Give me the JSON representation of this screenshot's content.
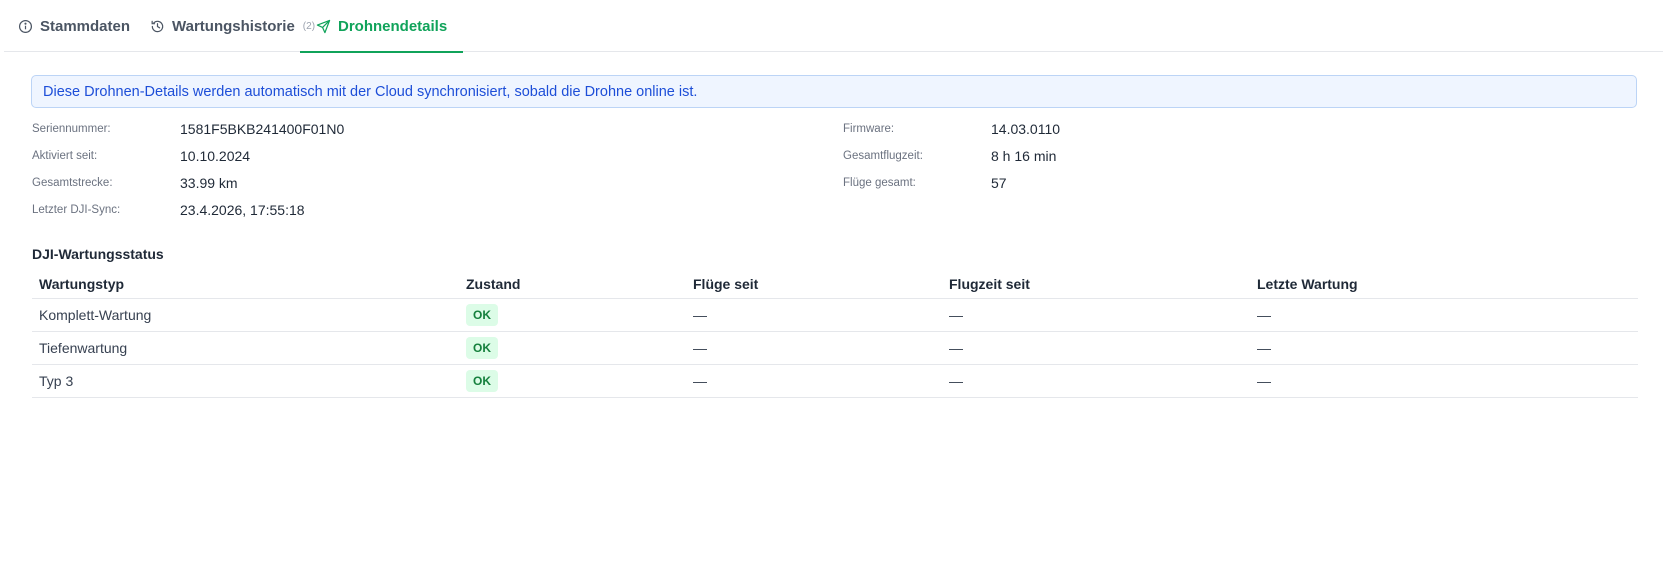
{
  "tabs": [
    {
      "label": "Stammdaten",
      "icon": "info-icon"
    },
    {
      "label": "Wartungshistorie",
      "count": "(2)",
      "icon": "history-icon"
    },
    {
      "label": "Drohnendetails",
      "icon": "send-icon",
      "active": true
    }
  ],
  "banner": "Diese Drohnen-Details werden automatisch mit der Cloud synchronisiert, sobald die Drohne online ist.",
  "details_left": [
    {
      "label": "Seriennummer:",
      "value": "1581F5BKB241400F01N0"
    },
    {
      "label": "Aktiviert seit:",
      "value": "10.10.2024"
    },
    {
      "label": "Gesamtstrecke:",
      "value": "33.99 km"
    },
    {
      "label": "Letzter DJI-Sync:",
      "value": "23.4.2026, 17:55:18"
    }
  ],
  "details_right": [
    {
      "label": "Firmware:",
      "value": "14.03.0110"
    },
    {
      "label": "Gesamtflugzeit:",
      "value": "8 h 16 min"
    },
    {
      "label": "Flüge gesamt:",
      "value": "57"
    }
  ],
  "maintenance": {
    "title": "DJI-Wartungsstatus",
    "headers": [
      "Wartungstyp",
      "Zustand",
      "Flüge seit",
      "Flugzeit seit",
      "Letzte Wartung"
    ],
    "rows": [
      {
        "type": "Komplett-Wartung",
        "status": "OK",
        "flights_since": "—",
        "flighttime_since": "—",
        "last": "—"
      },
      {
        "type": "Tiefenwartung",
        "status": "OK",
        "flights_since": "—",
        "flighttime_since": "—",
        "last": "—"
      },
      {
        "type": "Typ 3",
        "status": "OK",
        "flights_since": "—",
        "flighttime_since": "—",
        "last": "—"
      }
    ]
  },
  "colors": {
    "accent": "#10a35a",
    "banner_bg": "#eff5ff",
    "banner_text": "#1d4ed8",
    "badge_bg": "#dcfce7",
    "badge_text": "#15803d"
  }
}
